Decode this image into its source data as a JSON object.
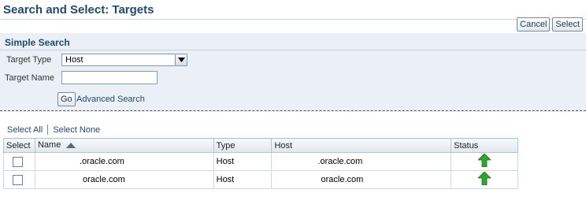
{
  "page": {
    "title": "Search and Select: Targets"
  },
  "actions": {
    "cancel_label": "Cancel",
    "select_label": "Select"
  },
  "search": {
    "section_title": "Simple Search",
    "target_type_label": "Target Type",
    "target_type_value": "Host",
    "target_name_label": "Target Name",
    "target_name_value": "",
    "go_label": "Go",
    "advanced_label": "Advanced Search"
  },
  "selection": {
    "select_all": "Select All",
    "select_none": "Select None"
  },
  "table": {
    "headers": {
      "select": "Select",
      "name": "Name",
      "type": "Type",
      "host": "Host",
      "status": "Status"
    },
    "rows": [
      {
        "name": ".oracle.com",
        "type": "Host",
        "host": ".oracle.com",
        "status": "up"
      },
      {
        "name": "oracle.com",
        "type": "Host",
        "host": "oracle.com",
        "status": "up"
      }
    ]
  },
  "colors": {
    "title": "#1f4a6e",
    "panel": "#eaf0f6",
    "status_up": "#2ea32e"
  },
  "icons": {
    "sort": "sort-ascending-icon",
    "dropdown": "chevron-down-icon",
    "status": "status-up-arrow-icon"
  }
}
